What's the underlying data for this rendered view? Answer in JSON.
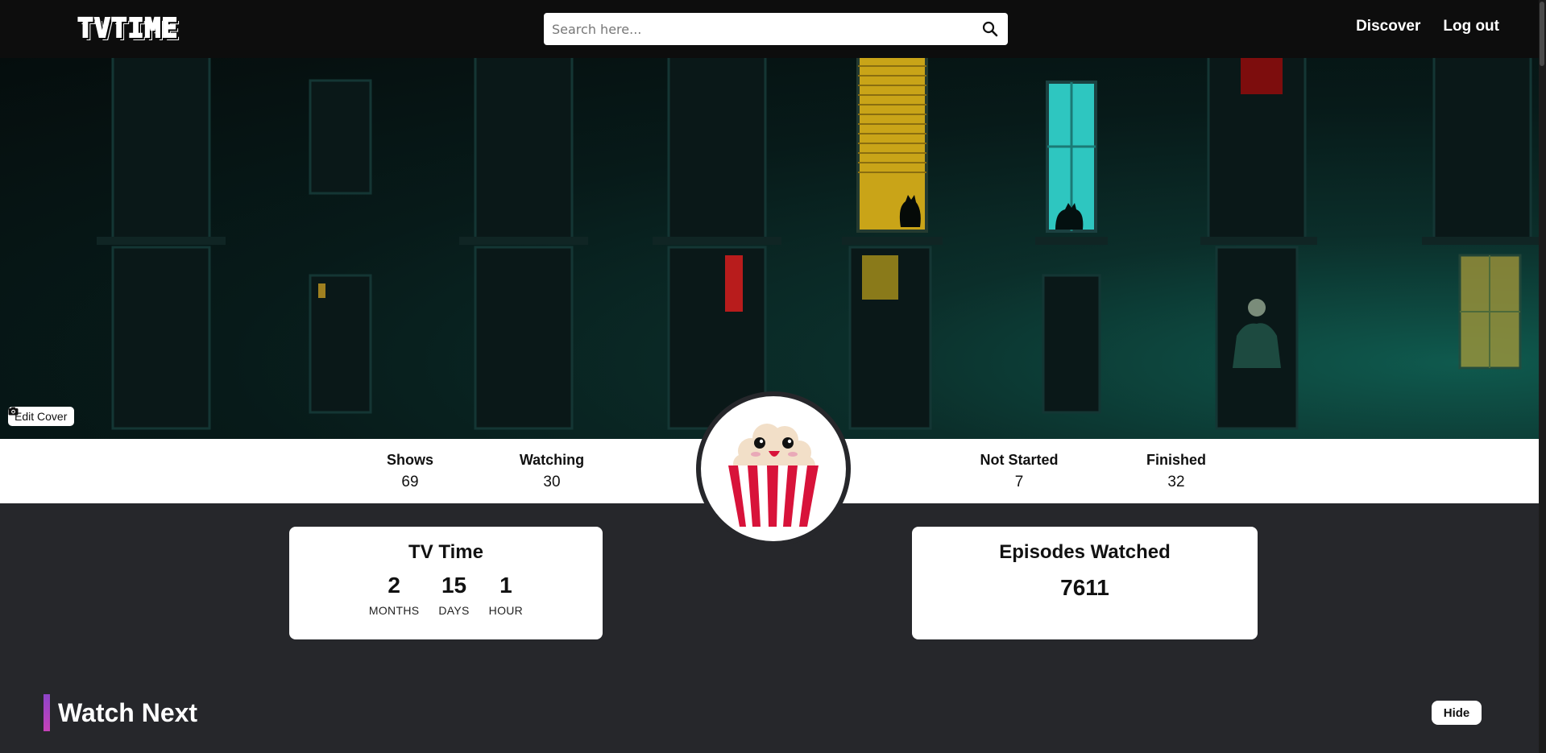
{
  "header": {
    "logo_text": "TVTIME",
    "search": {
      "placeholder": "Search here...",
      "value": ""
    },
    "nav": {
      "discover": "Discover",
      "logout": "Log out"
    }
  },
  "cover": {
    "edit_label": "Edit Cover"
  },
  "stats": {
    "shows": {
      "label": "Shows",
      "value": "69"
    },
    "watching": {
      "label": "Watching",
      "value": "30"
    },
    "not_started": {
      "label": "Not Started",
      "value": "7"
    },
    "finished": {
      "label": "Finished",
      "value": "32"
    }
  },
  "tv_time": {
    "title": "TV Time",
    "months": {
      "value": "2",
      "unit": "MONTHS"
    },
    "days": {
      "value": "15",
      "unit": "DAYS"
    },
    "hours": {
      "value": "1",
      "unit": "HOUR"
    }
  },
  "episodes": {
    "title": "Episodes Watched",
    "value": "7611"
  },
  "watch_next": {
    "title": "Watch Next",
    "hide_label": "Hide"
  },
  "colors": {
    "header_bg": "#0d0d0d",
    "page_bg": "#26272b",
    "accent_gradient_start": "#8e44c9",
    "accent_gradient_end": "#c542b8",
    "popcorn_red": "#d8133a"
  }
}
